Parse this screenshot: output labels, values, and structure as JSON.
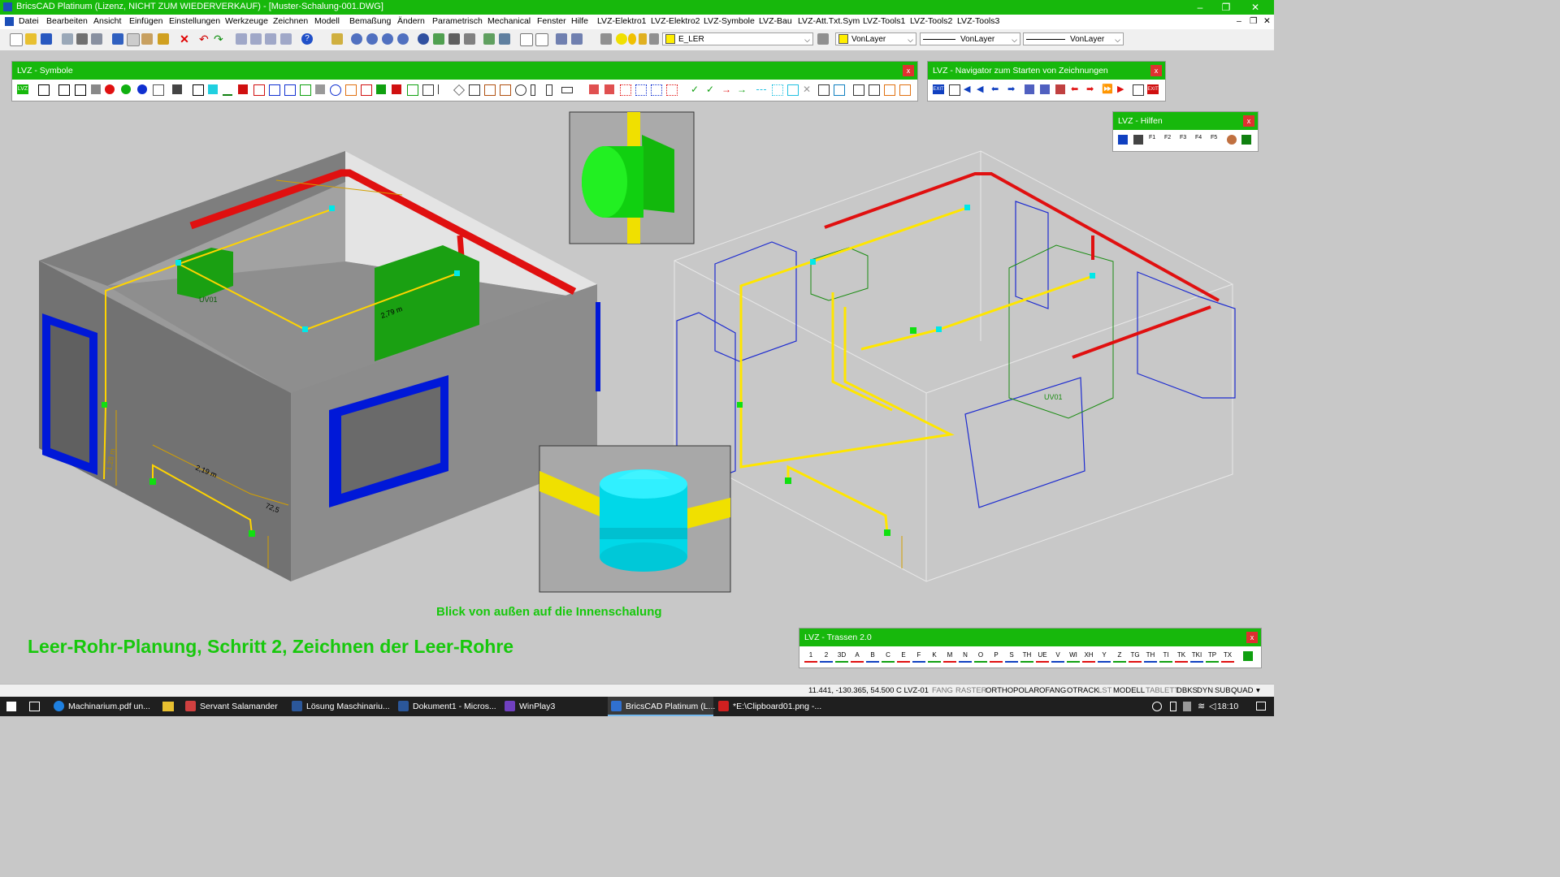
{
  "window": {
    "title": "BricsCAD Platinum (Lizenz, NICHT ZUM WIEDERVERKAUF) - [Muster-Schalung-001.DWG]",
    "controls": [
      "–",
      "❐",
      "✕"
    ]
  },
  "menu": [
    "Datei",
    "Bearbeiten",
    "Ansicht",
    "Einfügen",
    "Einstellungen",
    "Werkzeuge",
    "Zeichnen",
    "Modell",
    "Bemaßung",
    "Ändern",
    "Parametrisch",
    "Mechanical",
    "Fenster",
    "Hilfe",
    "LVZ-Elektro1",
    "LVZ-Elektro2",
    "LVZ-Symbole",
    "LVZ-Bau",
    "LVZ-Att.Txt.Sym",
    "LVZ-Tools1",
    "LVZ-Tools2",
    "LVZ-Tools3"
  ],
  "toolbar": {
    "layer_value": "E_LER",
    "color_value": "VonLayer",
    "linetype_value": "VonLayer",
    "lineweight_value": "VonLayer"
  },
  "panels": {
    "symbole": {
      "title": "LVZ - Symbole",
      "first_icon": "LVZ"
    },
    "navigator": {
      "title": "LVZ - Navigator zum Starten von Zeichnungen",
      "exit1": "EXIT",
      "exit2": "EXIT"
    },
    "hilfen": {
      "title": "LVZ - Hilfen",
      "keys": [
        "F1",
        "F2",
        "F3",
        "F4",
        "F5"
      ]
    },
    "trassen": {
      "title": "LVZ - Trassen 2.0",
      "labels": [
        "1",
        "2",
        "3D",
        "A",
        "B",
        "C",
        "E",
        "F",
        "K",
        "M",
        "N",
        "O",
        "P",
        "S",
        "TH",
        "UE",
        "V",
        "WI",
        "XH",
        "Y",
        "Z",
        "TG",
        "TH",
        "TI",
        "TK",
        "TKI",
        "TP",
        "TX"
      ]
    }
  },
  "drawing": {
    "left_dims": [
      "2,79 m",
      "1,28 m",
      "2,19 m",
      "72,5"
    ],
    "left_label": "UV01",
    "right_label": "UV01",
    "caption_view": "Blick von außen auf die Innenschalung",
    "caption_main": "Leer-Rohr-Planung, Schritt 2, Zeichnen der Leer-Rohre"
  },
  "status": {
    "coords": "11.441, -130.365, 54.500",
    "layer": "C LVZ-01",
    "modes": [
      "FANG",
      "RASTER",
      "ORTHO",
      "POLAR",
      "OFANG",
      "OTRACK",
      "LST",
      "MODELL",
      "TABLETT",
      "DBKS",
      "DYN",
      "SUB",
      "QUAD"
    ]
  },
  "taskbar": {
    "items": [
      "Machinarium.pdf un...",
      "Servant Salamander",
      "Lösung Maschinariu...",
      "Dokument1 - Micros...",
      "WinPlay3",
      "BricsCAD Platinum (L...",
      "*E:\\Clipboard01.png -..."
    ],
    "clock": "18:10"
  },
  "colors": {
    "green": "#17b80c",
    "wall_dark": "#6a6a6a",
    "wall_mid": "#8b8b8b",
    "pipe_red": "#e01010",
    "pipe_yellow": "#ffee00",
    "box_green": "#1aa012",
    "window_blue": "#0000d8",
    "cyan": "#00e8e8"
  }
}
